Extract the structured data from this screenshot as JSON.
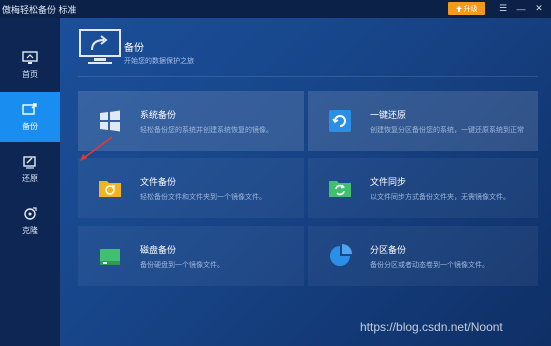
{
  "app": {
    "title": "傲梅轻松备份 标准",
    "upgrade_label": "升级"
  },
  "window_controls": {
    "menu": "☰",
    "minimize": "—",
    "close": "✕"
  },
  "sidebar": {
    "items": [
      {
        "label": "首页",
        "icon": "home-monitor-icon",
        "active": false
      },
      {
        "label": "备份",
        "icon": "backup-icon",
        "active": true
      },
      {
        "label": "还原",
        "icon": "restore-icon",
        "active": false
      },
      {
        "label": "克隆",
        "icon": "clone-icon",
        "active": false
      }
    ]
  },
  "header": {
    "title": "备份",
    "subtitle": "开始您的数据保护之旅"
  },
  "cards": [
    {
      "title": "系统备份",
      "desc": "轻松备份您的系统并创建系统恢复的镜像。",
      "icon": "windows-icon"
    },
    {
      "title": "一键还原",
      "desc": "创建恢复分区备份您的系统，一键还原系统到正常",
      "icon": "one-key-restore-icon"
    },
    {
      "title": "文件备份",
      "desc": "轻松备份文件和文件夹到一个镜像文件。",
      "icon": "folder-backup-icon"
    },
    {
      "title": "文件同步",
      "desc": "以文件同步方式备份文件夹，无需镜像文件。",
      "icon": "folder-sync-icon"
    },
    {
      "title": "磁盘备份",
      "desc": "备份硬盘到一个镜像文件。",
      "icon": "disk-icon"
    },
    {
      "title": "分区备份",
      "desc": "备份分区或者动态卷到一个镜像文件。",
      "icon": "partition-icon"
    }
  ],
  "colors": {
    "accent": "#1a8ef0",
    "upgrade": "#f39a1c",
    "icon_blue": "#2b8fe8",
    "icon_yellow": "#f2b321",
    "icon_green": "#3fbf6f"
  },
  "watermark": "https://blog.csdn.net/Noont"
}
